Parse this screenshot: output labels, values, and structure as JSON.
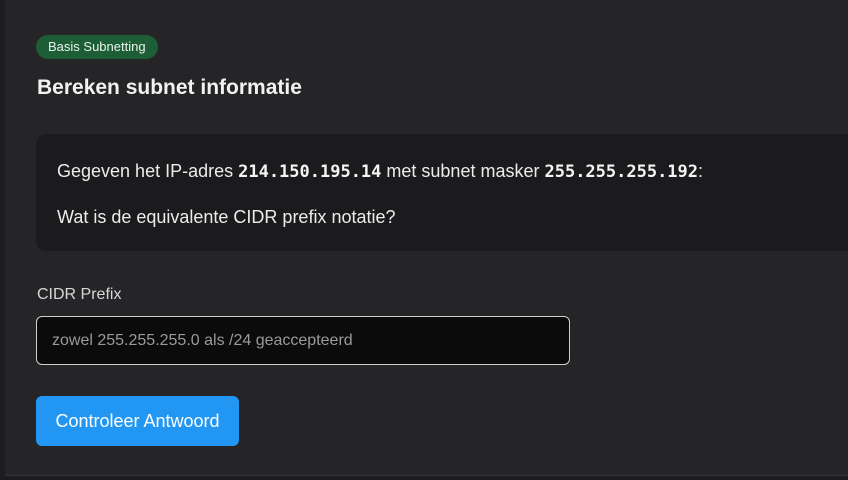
{
  "badge": {
    "label": "Basis Subnetting",
    "color": "#1e5e37"
  },
  "title": "Bereken subnet informatie",
  "question": {
    "prefix": "Gegeven het IP-adres ",
    "ip": "214.150.195.14",
    "middle": " met subnet masker ",
    "mask": "255.255.255.192",
    "suffix": ":",
    "prompt": "Wat is de equivalente CIDR prefix notatie?"
  },
  "field": {
    "label": "CIDR Prefix",
    "placeholder": "zowel 255.255.255.0 als /24 geaccepteerd",
    "value": ""
  },
  "submit": {
    "label": "Controleer Antwoord",
    "color": "#2196f3"
  }
}
